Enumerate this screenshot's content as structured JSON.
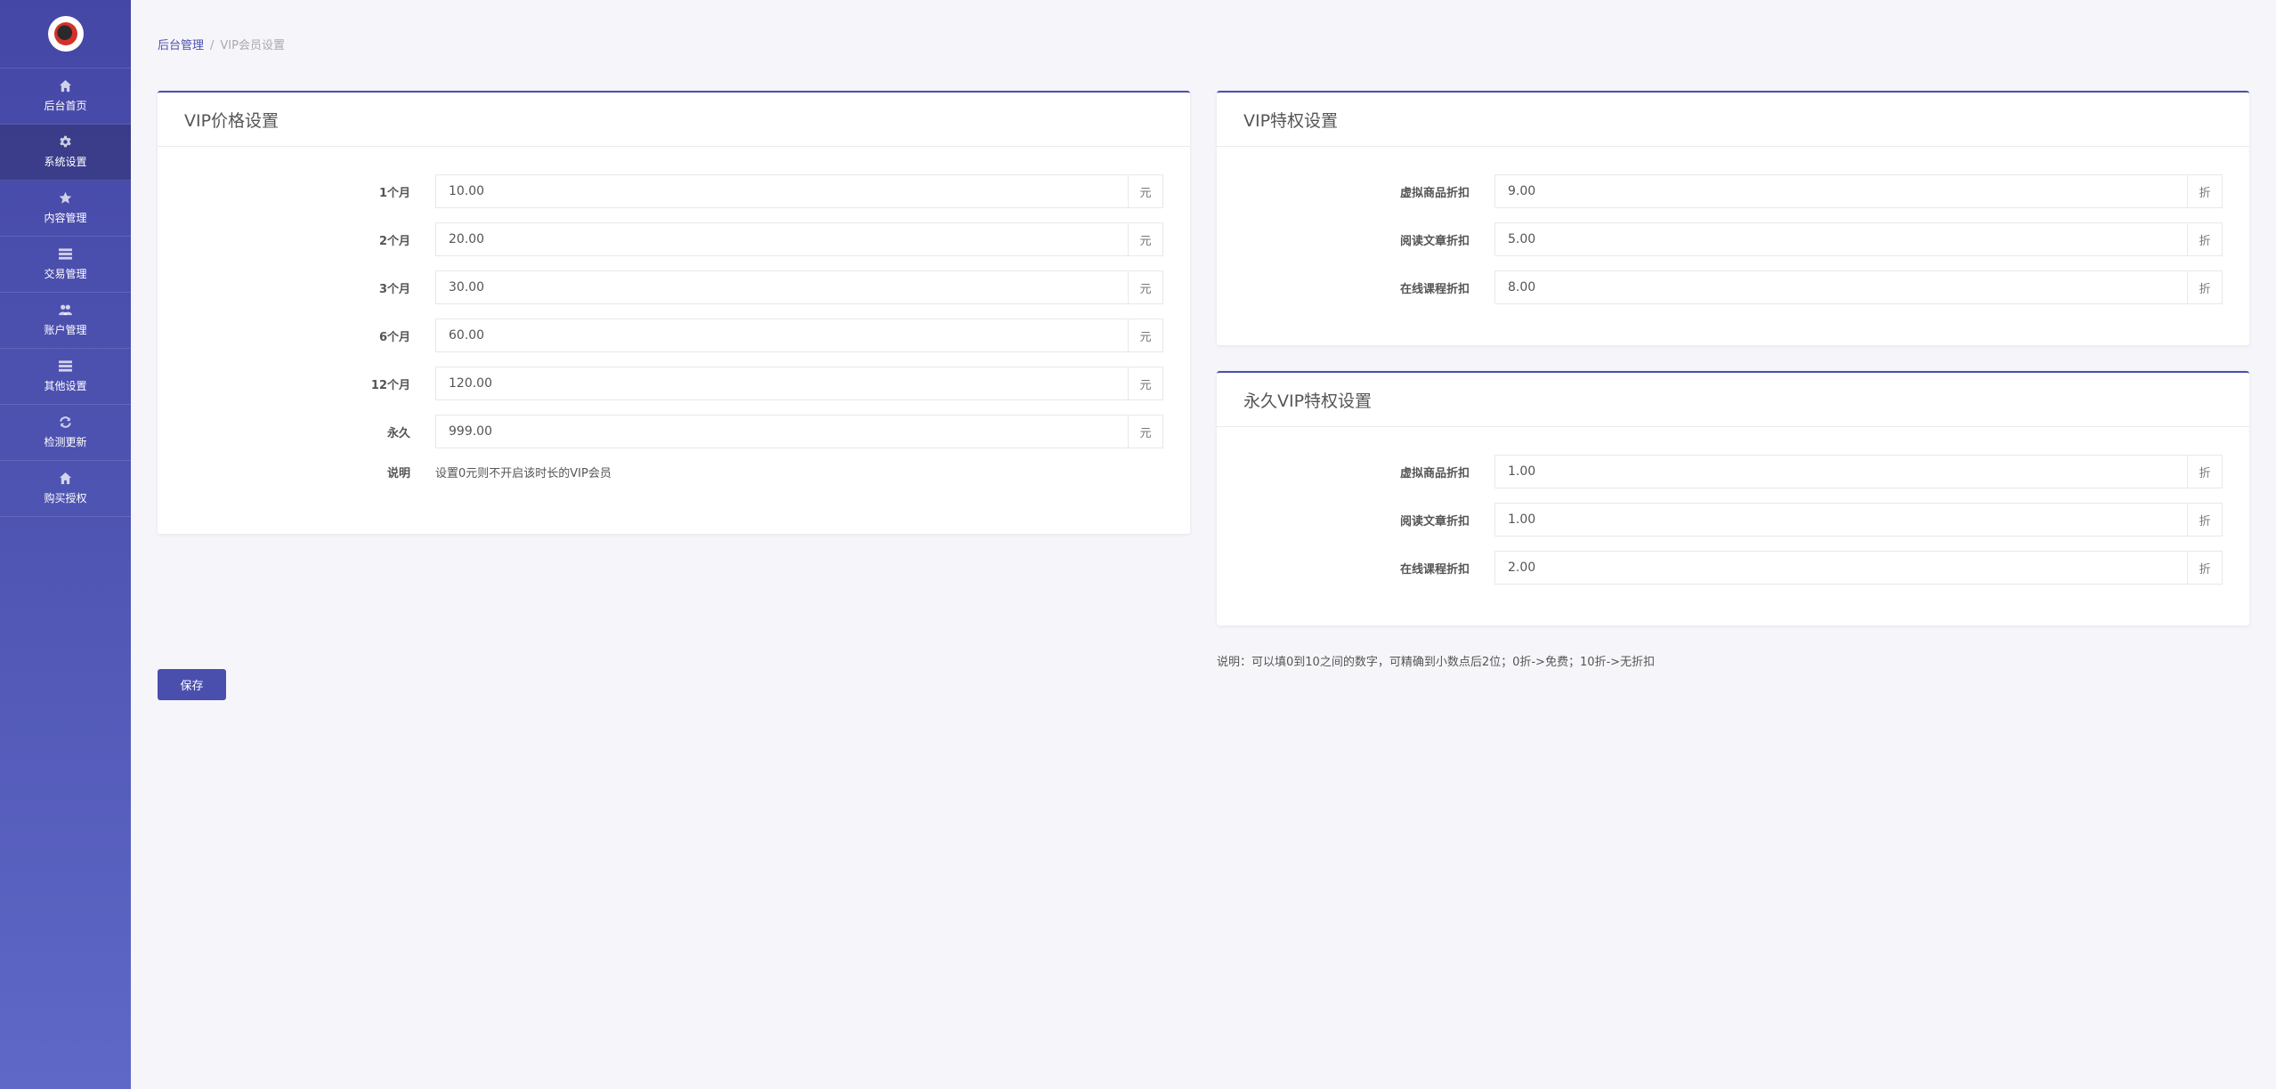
{
  "sidebar": {
    "items": [
      {
        "label": "后台首页",
        "icon": "home-icon"
      },
      {
        "label": "系统设置",
        "icon": "gear-icon"
      },
      {
        "label": "内容管理",
        "icon": "star-icon"
      },
      {
        "label": "交易管理",
        "icon": "list-icon"
      },
      {
        "label": "账户管理",
        "icon": "users-icon"
      },
      {
        "label": "其他设置",
        "icon": "list-icon"
      },
      {
        "label": "检测更新",
        "icon": "refresh-icon"
      },
      {
        "label": "购买授权",
        "icon": "home-icon"
      }
    ],
    "active_index": 1
  },
  "breadcrumb": {
    "root": "后台管理",
    "separator": "/",
    "current": "VIP会员设置"
  },
  "price_panel": {
    "title": "VIP价格设置",
    "rows": [
      {
        "label": "1个月",
        "value": "10.00",
        "unit": "元"
      },
      {
        "label": "2个月",
        "value": "20.00",
        "unit": "元"
      },
      {
        "label": "3个月",
        "value": "30.00",
        "unit": "元"
      },
      {
        "label": "6个月",
        "value": "60.00",
        "unit": "元"
      },
      {
        "label": "12个月",
        "value": "120.00",
        "unit": "元"
      },
      {
        "label": "永久",
        "value": "999.00",
        "unit": "元"
      }
    ],
    "note_label": "说明",
    "note_text": "设置0元则不开启该时长的VIP会员"
  },
  "privilege_panel": {
    "title": "VIP特权设置",
    "rows": [
      {
        "label": "虚拟商品折扣",
        "value": "9.00",
        "unit": "折"
      },
      {
        "label": "阅读文章折扣",
        "value": "5.00",
        "unit": "折"
      },
      {
        "label": "在线课程折扣",
        "value": "8.00",
        "unit": "折"
      }
    ]
  },
  "permanent_panel": {
    "title": "永久VIP特权设置",
    "rows": [
      {
        "label": "虚拟商品折扣",
        "value": "1.00",
        "unit": "折"
      },
      {
        "label": "阅读文章折扣",
        "value": "1.00",
        "unit": "折"
      },
      {
        "label": "在线课程折扣",
        "value": "2.00",
        "unit": "折"
      }
    ]
  },
  "discount_note": "说明：可以填0到10之间的数字，可精确到小数点后2位；0折->免费；10折->无折扣",
  "save_label": "保存",
  "colors": {
    "accent": "#4a4fae",
    "sidebar_top": "#4547a6",
    "sidebar_bottom": "#5f68c7",
    "background": "#f6f6fa"
  }
}
